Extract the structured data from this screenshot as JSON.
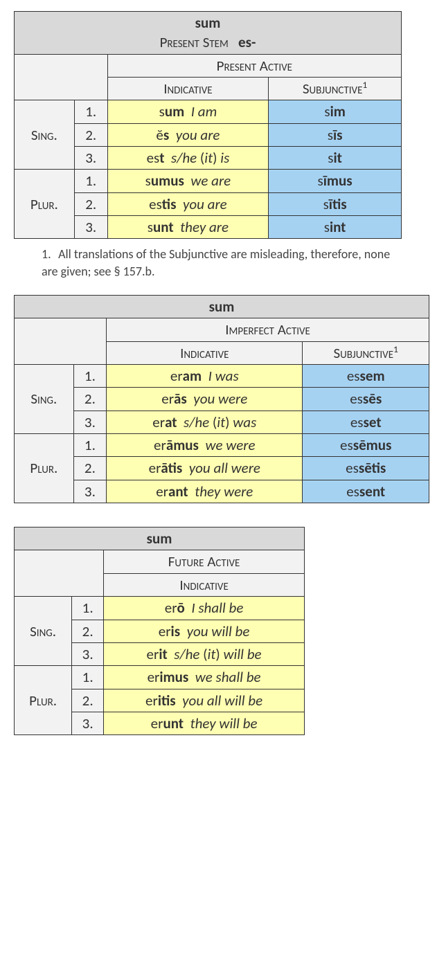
{
  "footnote": {
    "num": "1.",
    "text": "All translations of the Subjunctive are misleading, therefore, none are given; see § 157.b."
  },
  "table1": {
    "title_verb": "sum",
    "title_stem_label": "Present Stem",
    "title_stem_value": "es-",
    "tense": "Present Active",
    "mood_ind": "Indicative",
    "mood_subj": "Subjunctive",
    "sup": "1",
    "sing": "Sing.",
    "plur": "Plur.",
    "p": [
      "1.",
      "2.",
      "3."
    ],
    "ind": {
      "s1_a": "s",
      "s1_b": "um",
      "s1_g": "I am",
      "s2_a": "ĕ",
      "s2_b": "s",
      "s2_g": "you are",
      "s3_a": "es",
      "s3_b": "t",
      "s3_g1": "s/he",
      "s3_g2": "it",
      "s3_g3": "is",
      "p1_a": "s",
      "p1_b": "umus",
      "p1_g": "we are",
      "p2_a": "es",
      "p2_b": "tis",
      "p2_g": "you are",
      "p3_a": "s",
      "p3_b": "unt",
      "p3_g": "they are"
    },
    "subj": {
      "s1_a": "s",
      "s1_b": "im",
      "s2_a": "s",
      "s2_b": "īs",
      "s3_a": "s",
      "s3_b": "it",
      "p1_a": "s",
      "p1_b": "īmus",
      "p2_a": "s",
      "p2_b": "ītis",
      "p3_a": "s",
      "p3_b": "int"
    }
  },
  "table2": {
    "title_verb": "sum",
    "tense": "Imperfect Active",
    "mood_ind": "Indicative",
    "mood_subj": "Subjunctive",
    "sup": "1",
    "sing": "Sing.",
    "plur": "Plur.",
    "p": [
      "1.",
      "2.",
      "3."
    ],
    "ind": {
      "s1_a": "er",
      "s1_b": "am",
      "s1_g": "I was",
      "s2_a": "er",
      "s2_b": "ās",
      "s2_g": "you were",
      "s3_a": "er",
      "s3_b": "at",
      "s3_g1": "s/he",
      "s3_g2": "it",
      "s3_g3": "was",
      "p1_a": "er",
      "p1_b": "āmus",
      "p1_g": "we were",
      "p2_a": "er",
      "p2_b": "ātis",
      "p2_g": "you all  were",
      "p3_a": "er",
      "p3_b": "ant",
      "p3_g": "they were"
    },
    "subj": {
      "s1_a": "es",
      "s1_b": "sem",
      "s2_a": "es",
      "s2_b": "sēs",
      "s3_a": "es",
      "s3_b": "set",
      "p1_a": "es",
      "p1_b": "sēmus",
      "p2_a": "es",
      "p2_b": "sētis",
      "p3_a": "es",
      "p3_b": "sent"
    }
  },
  "table3": {
    "title_verb": "sum",
    "tense": "Future Active",
    "mood_ind": "Indicative",
    "sing": "Sing.",
    "plur": "Plur.",
    "p": [
      "1.",
      "2.",
      "3."
    ],
    "ind": {
      "s1_a": "er",
      "s1_b": "ō",
      "s1_g": "I shall be",
      "s2_a": "er",
      "s2_b": "is",
      "s2_g": "you will be",
      "s3_a": "er",
      "s3_b": "it",
      "s3_g1": "s/he",
      "s3_g2": "it",
      "s3_g3": "will be",
      "p1_a": "er",
      "p1_b": "imus",
      "p1_g": "we shall be",
      "p2_a": "er",
      "p2_b": "itis",
      "p2_g": "you all will be",
      "p3_a": "er",
      "p3_b": "unt",
      "p3_g": "they will be"
    }
  }
}
